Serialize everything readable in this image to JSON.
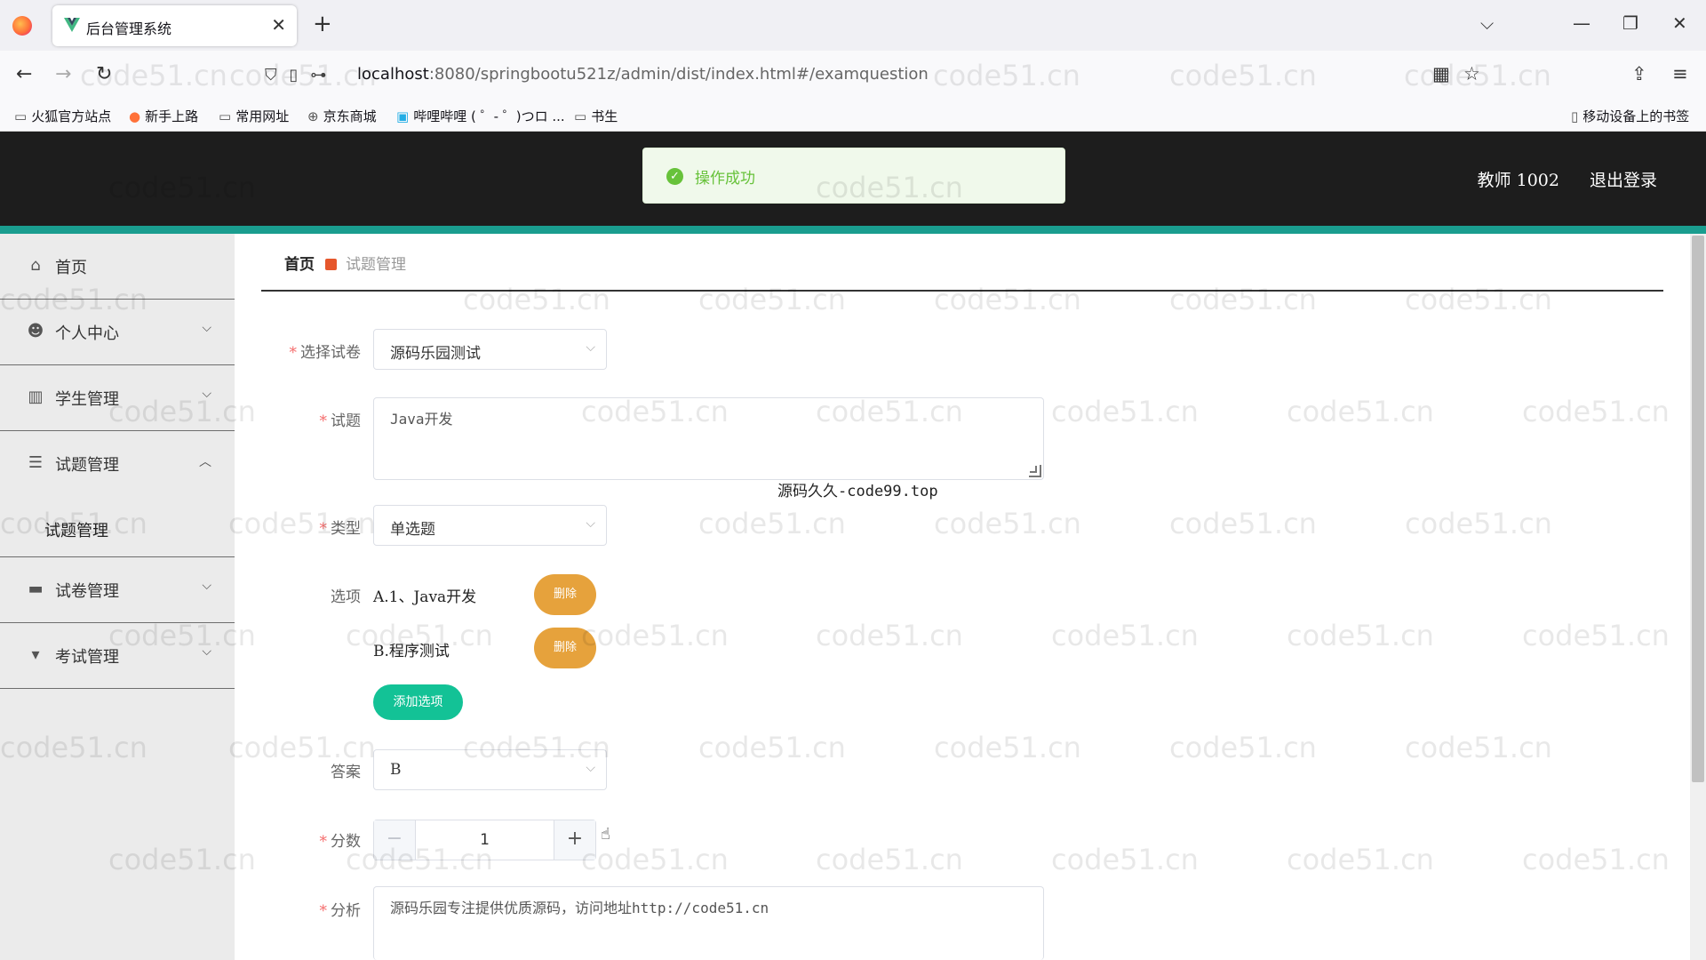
{
  "browser": {
    "tab_title": "后台管理系统",
    "url_host": "localhost",
    "url_path": ":8080/springbootu521z/admin/dist/index.html#/examquestion",
    "bookmarks": [
      "火狐官方站点",
      "新手上路",
      "常用网址",
      "京东商城",
      "哔哩哔哩 ( ゜- ゜)つロ ...",
      "书生"
    ],
    "mobile_bookmarks": "移动设备上的书签"
  },
  "header": {
    "user": "教师 1002",
    "logout": "退出登录",
    "toast": "操作成功"
  },
  "sidebar": {
    "items": [
      {
        "label": "首页",
        "icon": "home-icon"
      },
      {
        "label": "个人中心",
        "icon": "user-icon"
      },
      {
        "label": "学生管理",
        "icon": "book-icon"
      },
      {
        "label": "试题管理",
        "icon": "sliders-icon"
      },
      {
        "label": "试卷管理",
        "icon": "ticket-icon"
      },
      {
        "label": "考试管理",
        "icon": "monitor-icon"
      }
    ],
    "sub_item": "试题管理"
  },
  "breadcrumb": {
    "home": "首页",
    "current": "试题管理"
  },
  "form": {
    "paper_label": "选择试卷",
    "paper_value": "源码乐园测试",
    "question_label": "试题",
    "question_value": "Java开发",
    "type_label": "类型",
    "type_value": "单选题",
    "options_label": "选项",
    "options": [
      {
        "text": "A.1、Java开发",
        "delete": "删除"
      },
      {
        "text": "B.程序测试",
        "delete": "删除"
      }
    ],
    "add_option": "添加选项",
    "answer_label": "答案",
    "answer_value": "B",
    "score_label": "分数",
    "score_value": "1",
    "analysis_label": "分析",
    "analysis_value": "源码乐园专注提供优质源码，访问地址http://code51.cn"
  },
  "overlay_text": "源码久久-code99.top",
  "watermark": "code51.cn"
}
